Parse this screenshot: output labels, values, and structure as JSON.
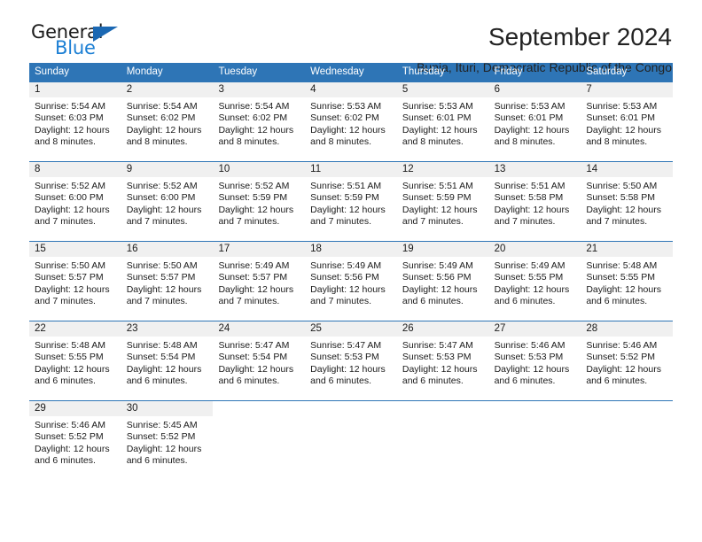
{
  "brand": {
    "name_part1": "General",
    "name_part2": "Blue",
    "triangle_icon": "triangle-icon",
    "accent_color": "#1c7fd4",
    "triangle_color": "#1b68b3"
  },
  "header": {
    "month_title": "September 2024",
    "location": "Bunia, Ituri, Democratic Republic of the Congo",
    "header_bg_color": "#2e75b6",
    "date_band_color": "#f0f0f0"
  },
  "calendar": {
    "weekdays": [
      "Sunday",
      "Monday",
      "Tuesday",
      "Wednesday",
      "Thursday",
      "Friday",
      "Saturday"
    ],
    "weeks": [
      [
        {
          "day": "1",
          "sunrise": "Sunrise: 5:54 AM",
          "sunset": "Sunset: 6:03 PM",
          "daylight": "Daylight: 12 hours and 8 minutes."
        },
        {
          "day": "2",
          "sunrise": "Sunrise: 5:54 AM",
          "sunset": "Sunset: 6:02 PM",
          "daylight": "Daylight: 12 hours and 8 minutes."
        },
        {
          "day": "3",
          "sunrise": "Sunrise: 5:54 AM",
          "sunset": "Sunset: 6:02 PM",
          "daylight": "Daylight: 12 hours and 8 minutes."
        },
        {
          "day": "4",
          "sunrise": "Sunrise: 5:53 AM",
          "sunset": "Sunset: 6:02 PM",
          "daylight": "Daylight: 12 hours and 8 minutes."
        },
        {
          "day": "5",
          "sunrise": "Sunrise: 5:53 AM",
          "sunset": "Sunset: 6:01 PM",
          "daylight": "Daylight: 12 hours and 8 minutes."
        },
        {
          "day": "6",
          "sunrise": "Sunrise: 5:53 AM",
          "sunset": "Sunset: 6:01 PM",
          "daylight": "Daylight: 12 hours and 8 minutes."
        },
        {
          "day": "7",
          "sunrise": "Sunrise: 5:53 AM",
          "sunset": "Sunset: 6:01 PM",
          "daylight": "Daylight: 12 hours and 8 minutes."
        }
      ],
      [
        {
          "day": "8",
          "sunrise": "Sunrise: 5:52 AM",
          "sunset": "Sunset: 6:00 PM",
          "daylight": "Daylight: 12 hours and 7 minutes."
        },
        {
          "day": "9",
          "sunrise": "Sunrise: 5:52 AM",
          "sunset": "Sunset: 6:00 PM",
          "daylight": "Daylight: 12 hours and 7 minutes."
        },
        {
          "day": "10",
          "sunrise": "Sunrise: 5:52 AM",
          "sunset": "Sunset: 5:59 PM",
          "daylight": "Daylight: 12 hours and 7 minutes."
        },
        {
          "day": "11",
          "sunrise": "Sunrise: 5:51 AM",
          "sunset": "Sunset: 5:59 PM",
          "daylight": "Daylight: 12 hours and 7 minutes."
        },
        {
          "day": "12",
          "sunrise": "Sunrise: 5:51 AM",
          "sunset": "Sunset: 5:59 PM",
          "daylight": "Daylight: 12 hours and 7 minutes."
        },
        {
          "day": "13",
          "sunrise": "Sunrise: 5:51 AM",
          "sunset": "Sunset: 5:58 PM",
          "daylight": "Daylight: 12 hours and 7 minutes."
        },
        {
          "day": "14",
          "sunrise": "Sunrise: 5:50 AM",
          "sunset": "Sunset: 5:58 PM",
          "daylight": "Daylight: 12 hours and 7 minutes."
        }
      ],
      [
        {
          "day": "15",
          "sunrise": "Sunrise: 5:50 AM",
          "sunset": "Sunset: 5:57 PM",
          "daylight": "Daylight: 12 hours and 7 minutes."
        },
        {
          "day": "16",
          "sunrise": "Sunrise: 5:50 AM",
          "sunset": "Sunset: 5:57 PM",
          "daylight": "Daylight: 12 hours and 7 minutes."
        },
        {
          "day": "17",
          "sunrise": "Sunrise: 5:49 AM",
          "sunset": "Sunset: 5:57 PM",
          "daylight": "Daylight: 12 hours and 7 minutes."
        },
        {
          "day": "18",
          "sunrise": "Sunrise: 5:49 AM",
          "sunset": "Sunset: 5:56 PM",
          "daylight": "Daylight: 12 hours and 7 minutes."
        },
        {
          "day": "19",
          "sunrise": "Sunrise: 5:49 AM",
          "sunset": "Sunset: 5:56 PM",
          "daylight": "Daylight: 12 hours and 6 minutes."
        },
        {
          "day": "20",
          "sunrise": "Sunrise: 5:49 AM",
          "sunset": "Sunset: 5:55 PM",
          "daylight": "Daylight: 12 hours and 6 minutes."
        },
        {
          "day": "21",
          "sunrise": "Sunrise: 5:48 AM",
          "sunset": "Sunset: 5:55 PM",
          "daylight": "Daylight: 12 hours and 6 minutes."
        }
      ],
      [
        {
          "day": "22",
          "sunrise": "Sunrise: 5:48 AM",
          "sunset": "Sunset: 5:55 PM",
          "daylight": "Daylight: 12 hours and 6 minutes."
        },
        {
          "day": "23",
          "sunrise": "Sunrise: 5:48 AM",
          "sunset": "Sunset: 5:54 PM",
          "daylight": "Daylight: 12 hours and 6 minutes."
        },
        {
          "day": "24",
          "sunrise": "Sunrise: 5:47 AM",
          "sunset": "Sunset: 5:54 PM",
          "daylight": "Daylight: 12 hours and 6 minutes."
        },
        {
          "day": "25",
          "sunrise": "Sunrise: 5:47 AM",
          "sunset": "Sunset: 5:53 PM",
          "daylight": "Daylight: 12 hours and 6 minutes."
        },
        {
          "day": "26",
          "sunrise": "Sunrise: 5:47 AM",
          "sunset": "Sunset: 5:53 PM",
          "daylight": "Daylight: 12 hours and 6 minutes."
        },
        {
          "day": "27",
          "sunrise": "Sunrise: 5:46 AM",
          "sunset": "Sunset: 5:53 PM",
          "daylight": "Daylight: 12 hours and 6 minutes."
        },
        {
          "day": "28",
          "sunrise": "Sunrise: 5:46 AM",
          "sunset": "Sunset: 5:52 PM",
          "daylight": "Daylight: 12 hours and 6 minutes."
        }
      ],
      [
        {
          "day": "29",
          "sunrise": "Sunrise: 5:46 AM",
          "sunset": "Sunset: 5:52 PM",
          "daylight": "Daylight: 12 hours and 6 minutes."
        },
        {
          "day": "30",
          "sunrise": "Sunrise: 5:45 AM",
          "sunset": "Sunset: 5:52 PM",
          "daylight": "Daylight: 12 hours and 6 minutes."
        },
        {
          "day": "",
          "sunrise": "",
          "sunset": "",
          "daylight": ""
        },
        {
          "day": "",
          "sunrise": "",
          "sunset": "",
          "daylight": ""
        },
        {
          "day": "",
          "sunrise": "",
          "sunset": "",
          "daylight": ""
        },
        {
          "day": "",
          "sunrise": "",
          "sunset": "",
          "daylight": ""
        },
        {
          "day": "",
          "sunrise": "",
          "sunset": "",
          "daylight": ""
        }
      ]
    ]
  }
}
